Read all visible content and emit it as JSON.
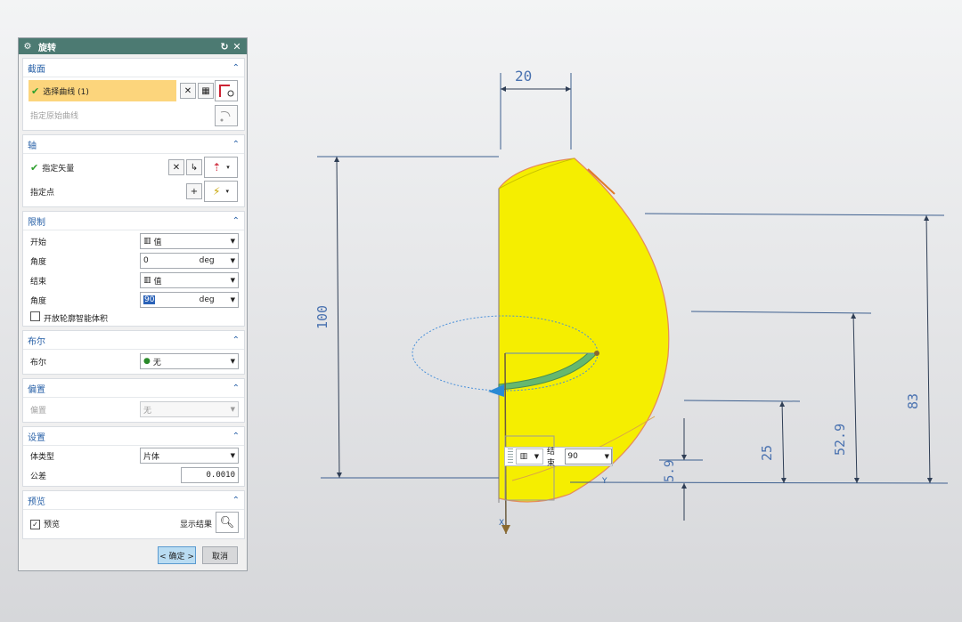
{
  "dialog": {
    "title": "旋转",
    "reset_icon": "↻",
    "close_icon": "✕",
    "section_curve": {
      "header": "截面",
      "select_curve": "选择曲线 (1)",
      "specify_origin_curve": "指定原始曲线"
    },
    "section_axis": {
      "header": "轴",
      "specify_vector": "指定矢量",
      "specify_point": "指定点"
    },
    "section_limits": {
      "header": "限制",
      "start_label": "开始",
      "start_value": "值",
      "start_angle_label": "角度",
      "start_angle_value": "0",
      "start_angle_unit": "deg",
      "end_label": "结束",
      "end_value": "值",
      "end_angle_label": "角度",
      "end_angle_value": "90",
      "end_angle_unit": "deg",
      "open_profile_label": "开放轮廓智能体积",
      "open_profile_checked": false
    },
    "section_boolean": {
      "header": "布尔",
      "label": "布尔",
      "value": "无"
    },
    "section_offset": {
      "header": "偏置",
      "label": "偏置",
      "value": "无"
    },
    "section_settings": {
      "header": "设置",
      "body_type_label": "体类型",
      "body_type_value": "片体",
      "tolerance_label": "公差",
      "tolerance_value": "0.0010"
    },
    "section_preview": {
      "header": "预览",
      "preview_label": "预览",
      "preview_checked": true,
      "show_result_label": "显示结果"
    },
    "ok_label": "< 确定 >",
    "cancel_label": "取消"
  },
  "viewport": {
    "dimensions": [
      "20",
      "100",
      "83",
      "52.9",
      "25",
      "5.9"
    ],
    "axis_labels": {
      "y": "Y",
      "x": "X"
    },
    "handle_toolbar": {
      "end_label": "结束",
      "end_value": "90"
    },
    "colors": {
      "surface": "#f5ee00",
      "dimension": "#3d5f8f",
      "dialog_title": "#4c7a72",
      "highlight": "#fcd57c"
    }
  }
}
